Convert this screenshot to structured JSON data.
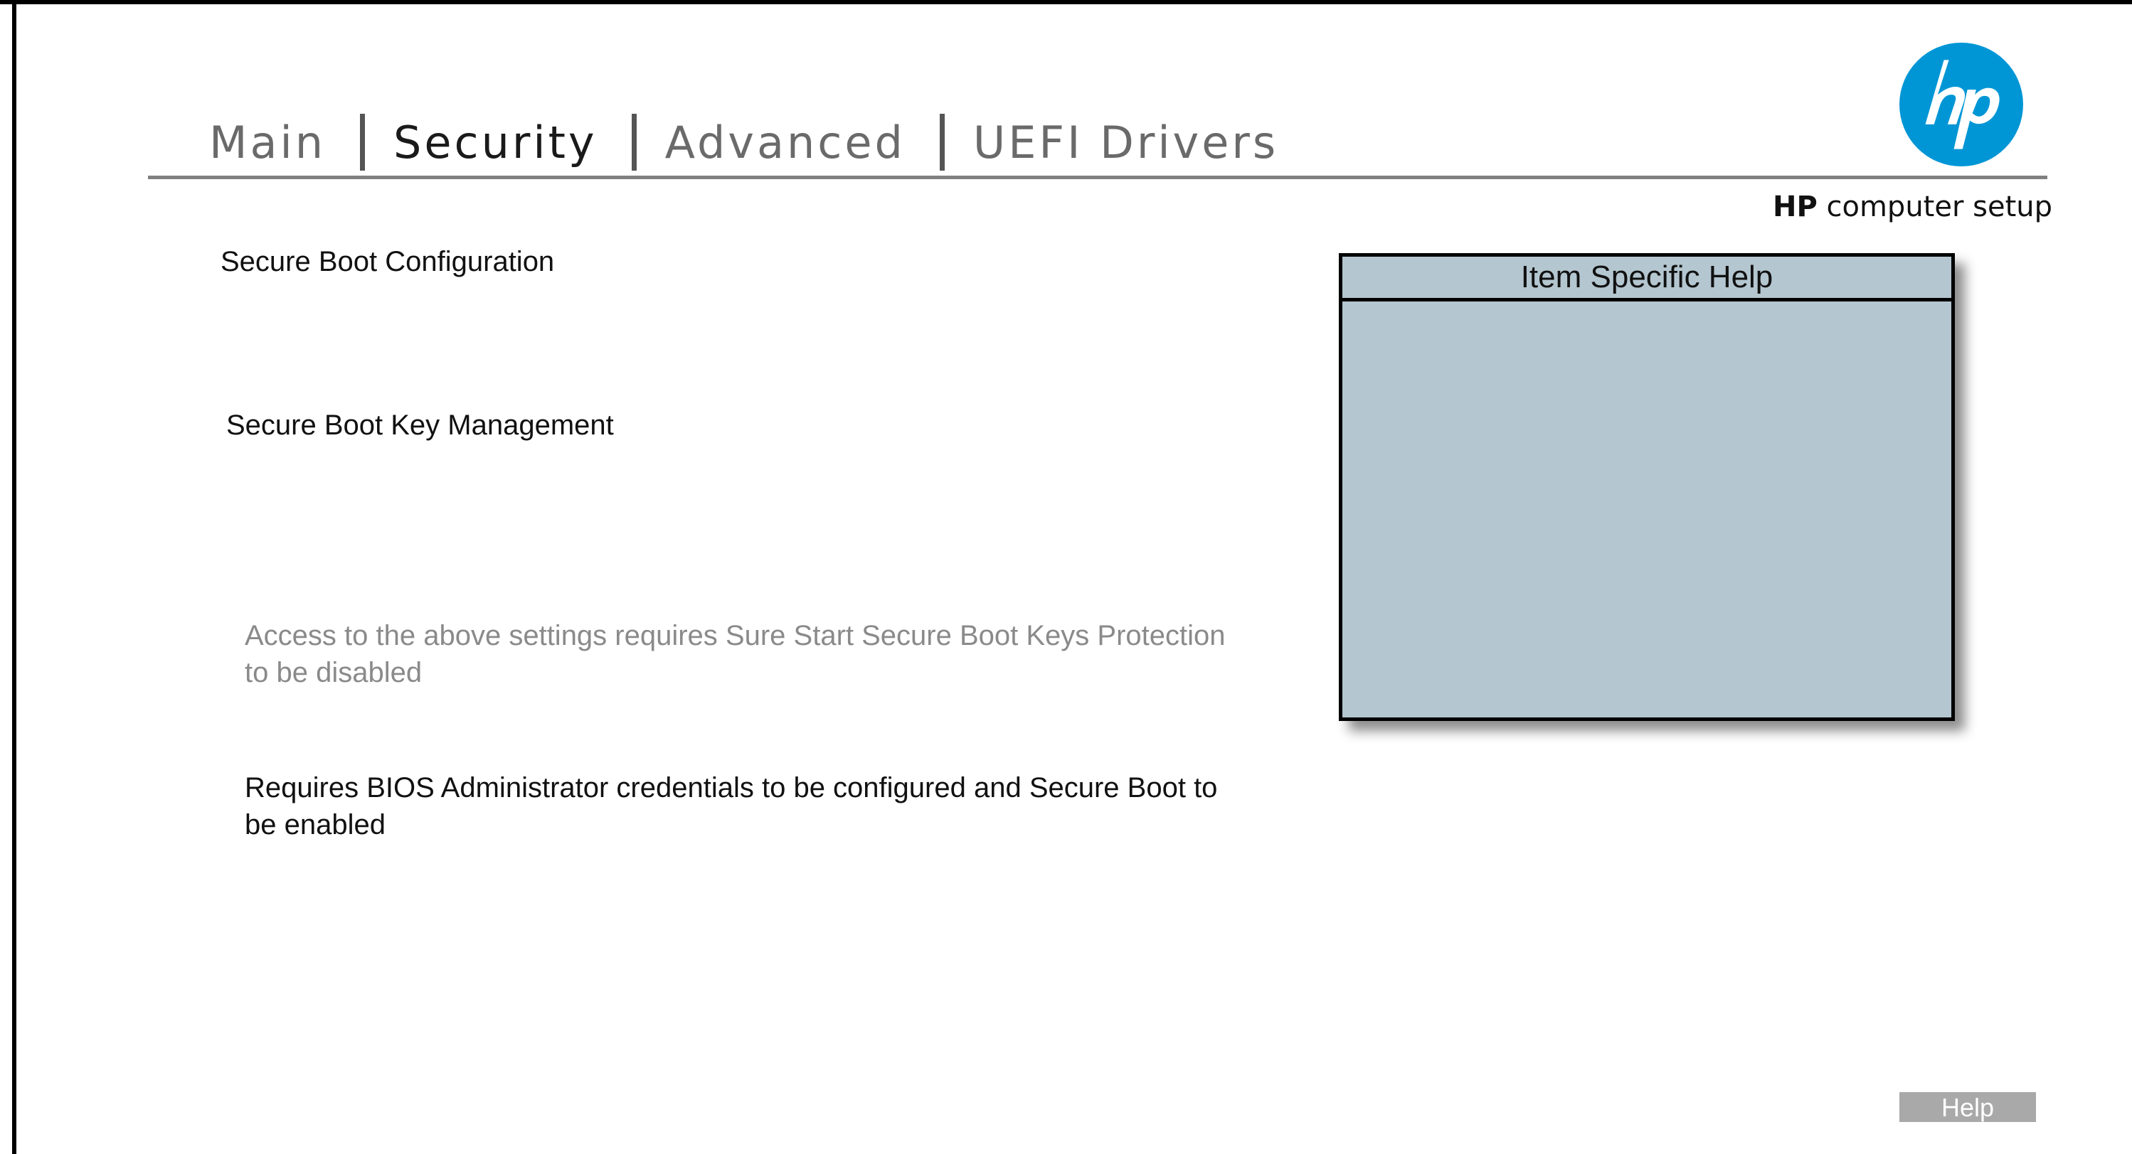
{
  "tabs": [
    {
      "label": "Main",
      "active": false
    },
    {
      "label": "Security",
      "active": true
    },
    {
      "label": "Advanced",
      "active": false
    },
    {
      "label": "UEFI Drivers",
      "active": false
    }
  ],
  "brand": {
    "bold": "HP",
    "rest": " computer setup",
    "logo_icon": "hp-logo-icon",
    "logo_color": "#0096d6"
  },
  "menu": {
    "item1": "Secure Boot Configuration",
    "item2": "Secure Boot Key Management",
    "note_disabled": "Access to the above settings requires Sure Start Secure Boot Keys Protection to be disabled",
    "note_requirements": "Requires BIOS Administrator credentials to be configured and Secure Boot to be enabled"
  },
  "help_panel": {
    "title": "Item Specific Help",
    "body": "",
    "background": "#b4c6d0"
  },
  "footer": {
    "help_button": "Help"
  }
}
